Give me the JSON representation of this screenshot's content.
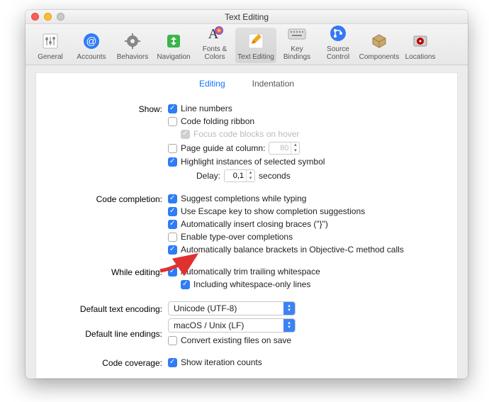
{
  "window": {
    "title": "Text Editing"
  },
  "toolbar": [
    {
      "label": "General",
      "icon": "sliders"
    },
    {
      "label": "Accounts",
      "icon": "at"
    },
    {
      "label": "Behaviors",
      "icon": "gear"
    },
    {
      "label": "Navigation",
      "icon": "arrows"
    },
    {
      "label": "Fonts & Colors",
      "icon": "font"
    },
    {
      "label": "Text Editing",
      "icon": "pencil",
      "selected": true
    },
    {
      "label": "Key Bindings",
      "icon": "keyboard"
    },
    {
      "label": "Source Control",
      "icon": "scm"
    },
    {
      "label": "Components",
      "icon": "box"
    },
    {
      "label": "Locations",
      "icon": "drive"
    }
  ],
  "tabs": {
    "editing": "Editing",
    "indentation": "Indentation"
  },
  "labels": {
    "show": "Show:",
    "code_completion": "Code completion:",
    "while_editing": "While editing:",
    "default_encoding": "Default text encoding:",
    "default_line_endings": "Default line endings:",
    "code_coverage": "Code coverage:",
    "delay": "Delay:",
    "seconds": "seconds"
  },
  "show": {
    "line_numbers": "Line numbers",
    "code_folding_ribbon": "Code folding ribbon",
    "focus_hover": "Focus code blocks on hover",
    "page_guide": "Page guide at column:",
    "page_guide_value": "80",
    "highlight_instances": "Highlight instances of selected symbol",
    "delay_value": "0,1"
  },
  "completion": {
    "suggest": "Suggest completions while typing",
    "escape": "Use Escape key to show completion suggestions",
    "braces": "Automatically insert closing braces (\"}\")",
    "typeover": "Enable type-over completions",
    "balance": "Automatically balance brackets in Objective-C method calls"
  },
  "while_editing": {
    "trim": "Automatically trim trailing whitespace",
    "including": "Including whitespace-only lines"
  },
  "encoding": {
    "value": "Unicode (UTF-8)"
  },
  "line_endings": {
    "value": "macOS / Unix (LF)",
    "convert": "Convert existing files on save"
  },
  "coverage": {
    "show_counts": "Show iteration counts"
  }
}
